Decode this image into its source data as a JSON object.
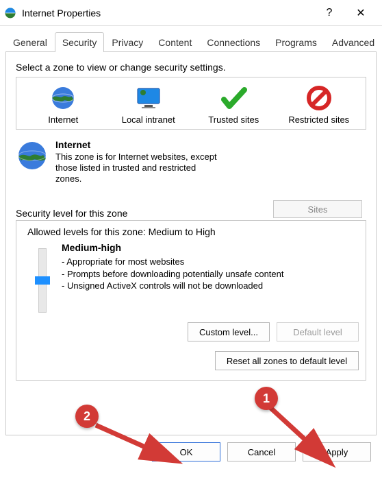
{
  "window": {
    "title": "Internet Properties",
    "help": "?",
    "close": "✕"
  },
  "tabs": {
    "items": [
      "General",
      "Security",
      "Privacy",
      "Content",
      "Connections",
      "Programs",
      "Advanced"
    ],
    "active_index": 1
  },
  "zone_instruction": "Select a zone to view or change security settings.",
  "zones": [
    {
      "key": "internet",
      "label": "Internet"
    },
    {
      "key": "local",
      "label": "Local intranet"
    },
    {
      "key": "trusted",
      "label": "Trusted sites"
    },
    {
      "key": "restricted",
      "label": "Restricted sites"
    }
  ],
  "selected_zone": {
    "name": "Internet",
    "desc": "This zone is for Internet websites, except those listed in trusted and restricted zones."
  },
  "sites_button": "Sites",
  "security": {
    "group_label": "Security level for this zone",
    "allowed": "Allowed levels for this zone: Medium to High",
    "level_name": "Medium-high",
    "bullets": [
      "Appropriate for most websites",
      "Prompts before downloading potentially unsafe content",
      "Unsigned ActiveX controls will not be downloaded"
    ],
    "custom_button": "Custom level...",
    "default_button": "Default level",
    "reset_button": "Reset all zones to default level"
  },
  "dialog_buttons": {
    "ok": "OK",
    "cancel": "Cancel",
    "apply": "Apply"
  },
  "annotations": {
    "badge1": "1",
    "badge2": "2"
  }
}
